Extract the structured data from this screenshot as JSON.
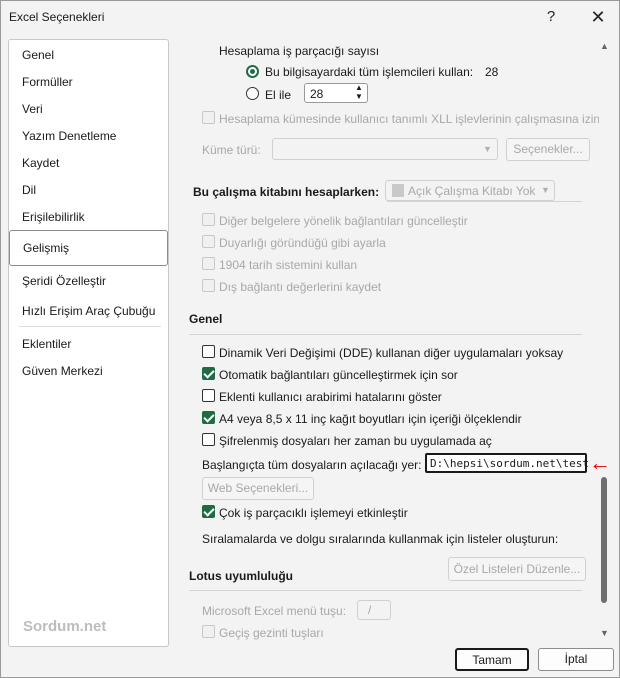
{
  "window": {
    "title": "Excel Seçenekleri",
    "help_glyph": "?",
    "close_glyph": "✕"
  },
  "sidebar": {
    "items": [
      {
        "label": "Genel"
      },
      {
        "label": "Formüller"
      },
      {
        "label": "Veri"
      },
      {
        "label": "Yazım Denetleme"
      },
      {
        "label": "Kaydet"
      },
      {
        "label": "Dil"
      },
      {
        "label": "Erişilebilirlik"
      },
      {
        "label": "Gelişmiş",
        "selected": true
      },
      {
        "label": "Şeridi Özelleştir"
      },
      {
        "label": "Hızlı Erişim Araç Çubuğu"
      },
      {
        "label": "Eklentiler"
      },
      {
        "label": "Güven Merkezi"
      }
    ],
    "watermark": "Sordum.net"
  },
  "calc": {
    "threads_label": "Hesaplama iş parçacığı sayısı",
    "all_processors_label": "Bu bilgisayardaki tüm işlemcileri kullan:",
    "all_processors_value": "28",
    "manual_label": "El ile",
    "manual_value": "28",
    "cluster_label": "Hesaplama kümesinde kullanıcı tanımlı XLL işlevlerinin çalışmasına izin",
    "cluster_type_label": "Küme türü:",
    "cluster_type_value": "",
    "options_button": "Seçenekler..."
  },
  "workbook": {
    "section_label": "Bu çalışma kitabını hesaplarken:",
    "workbook_value": "Açık Çalışma Kitabı Yok",
    "options": [
      {
        "label": "Diğer belgelere yönelik bağlantıları güncelleştir",
        "checked": false
      },
      {
        "label": "Duyarlığı göründüğü gibi ayarla",
        "checked": false
      },
      {
        "label": "1904 tarih sistemini kullan",
        "checked": false
      },
      {
        "label": "Dış bağlantı değerlerini kaydet",
        "checked": false
      }
    ]
  },
  "general": {
    "section_label": "Genel",
    "options": [
      {
        "label": "Dinamik Veri Değişimi (DDE) kullanan diğer uygulamaları yoksay",
        "checked": false
      },
      {
        "label": "Otomatik bağlantıları güncelleştirmek için sor",
        "checked": true
      },
      {
        "label": "Eklenti kullanıcı arabirimi hatalarını göster",
        "checked": false
      },
      {
        "label": "A4 veya 8,5 x 11 inç kağıt boyutları için içeriği ölçeklendir",
        "checked": true
      },
      {
        "label": "Şifrelenmiş dosyaları her zaman bu uygulamada aç",
        "checked": false
      }
    ],
    "startup_label": "Başlangıçta tüm dosyaların açılacağı yer:",
    "startup_value": "D:\\hepsi\\sordum.net\\test",
    "web_options_button": "Web Seçenekleri...",
    "multithread_label": "Çok iş parçacıklı işlemeyi etkinleştir",
    "multithread_checked": true,
    "custom_lists_label": "Sıralamalarda ve dolgu sıralarında kullanmak için listeler oluşturun:",
    "custom_lists_button": "Özel Listeleri Düzenle..."
  },
  "lotus": {
    "section_label": "Lotus uyumluluğu",
    "menu_key_label": "Microsoft Excel menü tuşu:",
    "menu_key_value": "/",
    "transition_nav_label": "Geçiş gezinti tuşları"
  },
  "buttons": {
    "ok": "Tamam",
    "cancel": "İptal"
  },
  "colors": {
    "accent": "#1f6b45",
    "annotation_arrow": "#e00000"
  }
}
